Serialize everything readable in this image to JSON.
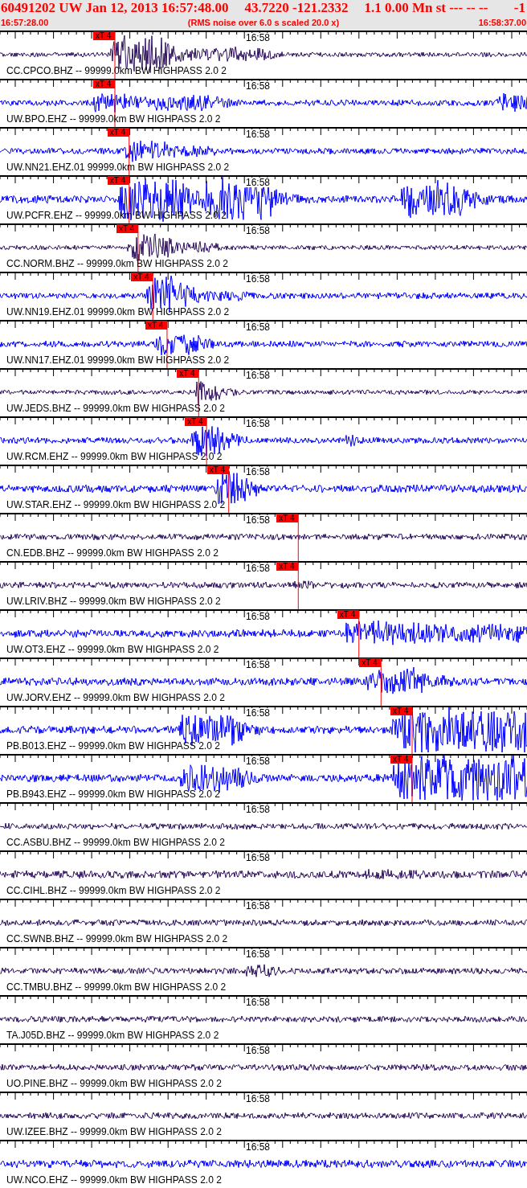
{
  "header": {
    "event": "60491202 UW Jan 12, 2013 16:57:48.00",
    "location": "43.7220 -121.2332",
    "magnitude": "1.1 0.00 Mn st --- -- --",
    "flag": "-1",
    "start_time": "16:57:28.00",
    "note": "(RMS noise over 6.0 s scaled 20.0 x)",
    "end_time": "16:58:37.00"
  },
  "traces": [
    {
      "label": "CC.CPCO.BHZ -- 99999.0km BW HIGHPASS 2.0 2",
      "color": "#2d0f5e",
      "time_mark": "16:58",
      "pick": {
        "label": "xT 4",
        "level": 0.218
      }
    },
    {
      "label": "UW.BPO.EHZ -- 99999.0km BW HIGHPASS 2.0 2",
      "color": "#0000ff",
      "time_mark": "16:58",
      "pick": {
        "label": "xT 4",
        "level": 0.218
      }
    },
    {
      "label": "UW.NN21.EHZ.01 99999.0km BW HIGHPASS 2.0 2",
      "color": "#0000ff",
      "time_mark": "16:58",
      "pick": {
        "label": "xT 4",
        "level": 0.245
      }
    },
    {
      "label": "UW.PCFR.EHZ -- 99999.0km BW HIGHPASS 2.0 2",
      "color": "#0000ff",
      "time_mark": "16:58",
      "pick": {
        "label": "xT 4",
        "level": 0.245
      }
    },
    {
      "label": "CC.NORM.BHZ -- 99999.0km BW HIGHPASS 2.0 2",
      "color": "#2d0f5e",
      "time_mark": "16:58",
      "pick": {
        "label": "xT 4",
        "level": 0.262
      }
    },
    {
      "label": "UW.NN19.EHZ.01 99999.0km BW HIGHPASS 2.0 2",
      "color": "#0000ff",
      "time_mark": "16:58",
      "pick": {
        "label": "xT 4",
        "level": 0.29
      }
    },
    {
      "label": "UW.NN17.EHZ.01 99999.0km BW HIGHPASS 2.0 2",
      "color": "#0000ff",
      "time_mark": "16:58",
      "pick": {
        "label": "xT 4",
        "level": 0.317
      }
    },
    {
      "label": "UW.JEDS.BHZ -- 99999.0km BW HIGHPASS 2.0 2",
      "color": "#2d0f5e",
      "time_mark": "16:58",
      "pick": {
        "label": "xT 4",
        "level": 0.377
      }
    },
    {
      "label": "UW.RCM.EHZ -- 99999.0km BW HIGHPASS 2.0 2",
      "color": "#0000ff",
      "time_mark": "16:58",
      "pick": {
        "label": "xT 4",
        "level": 0.392
      }
    },
    {
      "label": "UW.STAR.EHZ -- 99999.0km BW HIGHPASS 2.0 2",
      "color": "#0000ff",
      "time_mark": "16:58",
      "pick": {
        "label": "xT 4",
        "level": 0.434
      }
    },
    {
      "label": "CN.EDB.BHZ -- 99999.0km BW HIGHPASS 2.0 2",
      "color": "#2d0f5e",
      "time_mark": "16:58",
      "pick": {
        "label": "xT 4",
        "level": 0.566
      }
    },
    {
      "label": "UW.LRIV.BHZ -- 99999.0km BW HIGHPASS 2.0 2",
      "color": "#2d0f5e",
      "time_mark": "16:58",
      "pick": {
        "label": "xT 4",
        "level": 0.566
      }
    },
    {
      "label": "UW.OT3.EHZ -- 99999.0km BW HIGHPASS 2.0 2",
      "color": "#0000ff",
      "time_mark": "16:58",
      "pick": {
        "label": "xT 4",
        "level": 0.681
      }
    },
    {
      "label": "UW.JORV.EHZ -- 99999.0km BW HIGHPASS 2.0 2",
      "color": "#0000ff",
      "time_mark": "16:58",
      "pick": {
        "label": "xT 4",
        "level": 0.723
      }
    },
    {
      "label": "PB.B013.EHZ -- 99999.0km BW HIGHPASS 2.0 2",
      "color": "#0000ff",
      "time_mark": "16:58",
      "pick": {
        "label": "xT 4",
        "level": 0.782
      }
    },
    {
      "label": "PB.B943.EHZ -- 99999.0km BW HIGHPASS 2.0 2",
      "color": "#0000ff",
      "time_mark": "16:58",
      "pick": {
        "label": "xT 4",
        "level": 0.782
      }
    },
    {
      "label": "CC.ASBU.BHZ -- 99999.0km BW HIGHPASS 2.0 2",
      "color": "#2d0f5e",
      "time_mark": "16:58"
    },
    {
      "label": "CC.CIHL.BHZ -- 99999.0km BW HIGHPASS 2.0 2",
      "color": "#2d0f5e",
      "time_mark": "16:58"
    },
    {
      "label": "CC.SWNB.BHZ -- 99999.0km BW HIGHPASS 2.0 2",
      "color": "#2d0f5e",
      "time_mark": "16:58"
    },
    {
      "label": "CC.TMBU.BHZ -- 99999.0km BW HIGHPASS 2.0 2",
      "color": "#2d0f5e",
      "time_mark": "16:58"
    },
    {
      "label": "TA.J05D.BHZ -- 99999.0km BW HIGHPASS 2.0 2",
      "color": "#2d0f5e",
      "time_mark": "16:58"
    },
    {
      "label": "UO.PINE.BHZ -- 99999.0km BW HIGHPASS 2.0 2",
      "color": "#2d0f5e",
      "time_mark": "16:58"
    },
    {
      "label": "UW.IZEE.BHZ -- 99999.0km BW HIGHPASS 2.0 2",
      "color": "#2d0f5e",
      "time_mark": "16:58"
    },
    {
      "label": "UW.NCO.EHZ -- 99999.0km BW HIGHPASS 2.0 2",
      "color": "#0000ff",
      "time_mark": "16:58"
    }
  ]
}
